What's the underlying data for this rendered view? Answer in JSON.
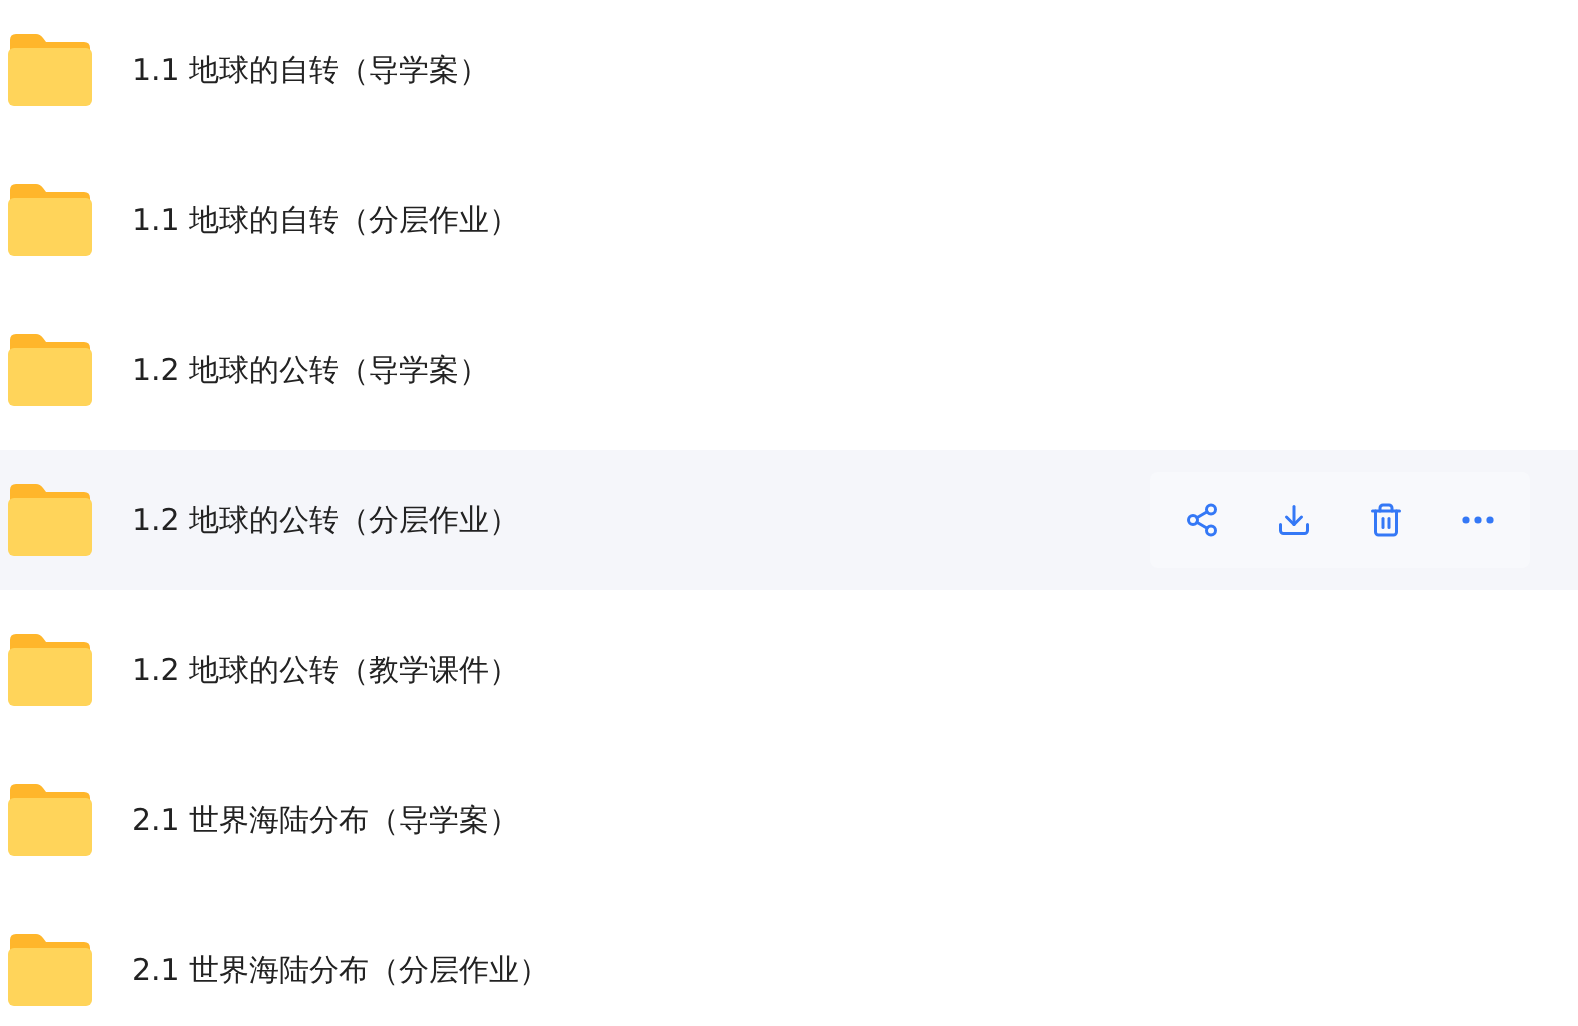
{
  "files": [
    {
      "name": "1.1 地球的自转（导学案）",
      "selected": false
    },
    {
      "name": "1.1 地球的自转（分层作业）",
      "selected": false
    },
    {
      "name": "1.2 地球的公转（导学案）",
      "selected": false
    },
    {
      "name": "1.2 地球的公转（分层作业）",
      "selected": true
    },
    {
      "name": "1.2 地球的公转（教学课件）",
      "selected": false
    },
    {
      "name": "2.1 世界海陆分布（导学案）",
      "selected": false
    },
    {
      "name": "2.1 世界海陆分布（分层作业）",
      "selected": false
    }
  ]
}
